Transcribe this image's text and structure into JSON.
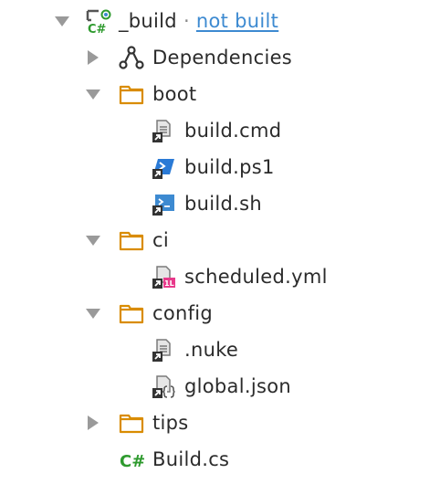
{
  "tree": {
    "root": {
      "name": "_build",
      "separator": "·",
      "status": "not built",
      "icon": "csharp-project-icon",
      "expanded": true
    },
    "items": [
      {
        "label": "Dependencies",
        "icon": "dependencies-icon",
        "expanded": false
      },
      {
        "label": "boot",
        "icon": "folder-icon",
        "expanded": true
      },
      {
        "label": "build.cmd",
        "icon": "cmd-file-icon"
      },
      {
        "label": "build.ps1",
        "icon": "powershell-file-icon"
      },
      {
        "label": "build.sh",
        "icon": "shell-file-icon"
      },
      {
        "label": "ci",
        "icon": "folder-icon",
        "expanded": true
      },
      {
        "label": "scheduled.yml",
        "icon": "yaml-file-icon"
      },
      {
        "label": "config",
        "icon": "folder-icon",
        "expanded": true
      },
      {
        "label": ".nuke",
        "icon": "file-link-icon"
      },
      {
        "label": "global.json",
        "icon": "json-file-icon"
      },
      {
        "label": "tips",
        "icon": "folder-icon",
        "expanded": false
      },
      {
        "label": "Build.cs",
        "icon": "csharp-file-icon"
      }
    ]
  },
  "colors": {
    "folder": "#d98c00",
    "csharp": "#2e9a2e",
    "link": "#3d8ad1",
    "arrow": "#9a9a9a",
    "powershell": "#2a7ad6",
    "yaml": "#e83a8b"
  }
}
